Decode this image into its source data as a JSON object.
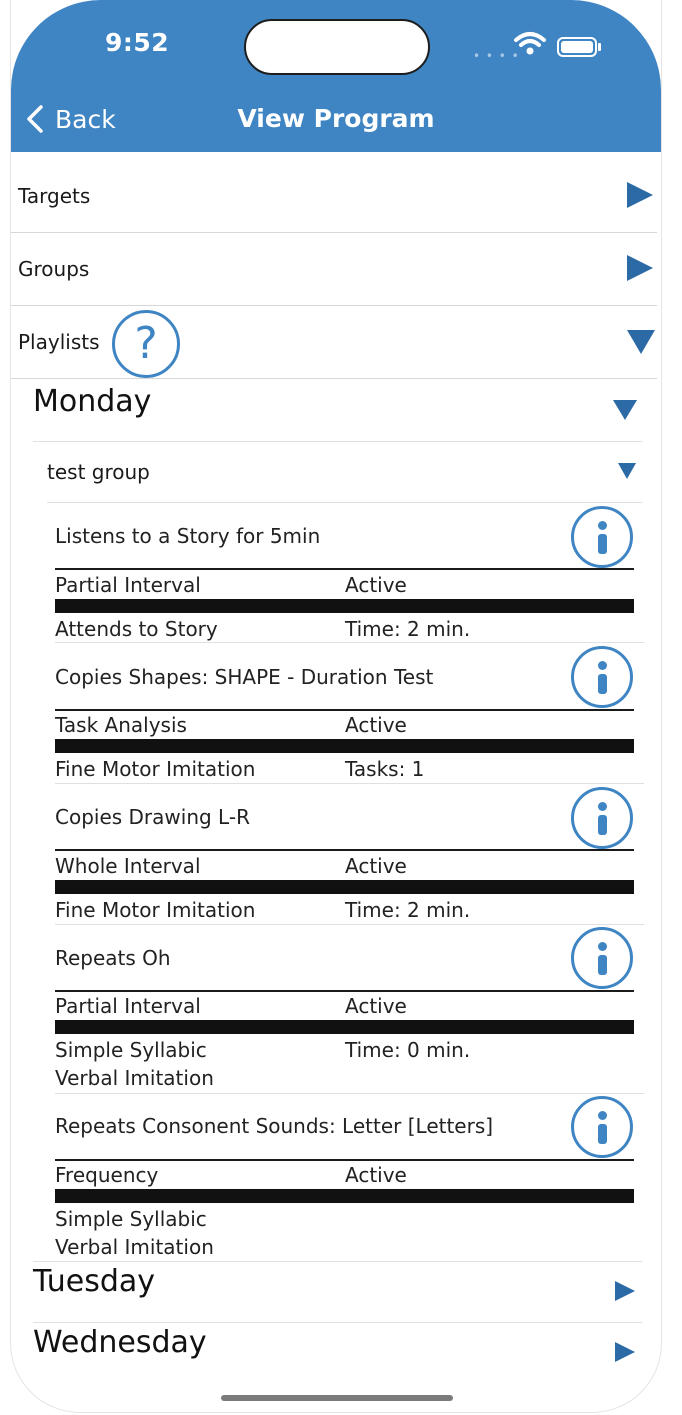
{
  "status_bar": {
    "time": "9:52"
  },
  "nav": {
    "back_label": "Back",
    "title": "View Program"
  },
  "sections": [
    {
      "label": "Targets"
    },
    {
      "label": "Groups"
    },
    {
      "label": "Playlists"
    }
  ],
  "help_glyph": "?",
  "days": [
    {
      "name": "Monday"
    },
    {
      "name": "Tuesday"
    },
    {
      "name": "Wednesday"
    }
  ],
  "group": {
    "name": "test group"
  },
  "items": [
    {
      "title": "Listens to a Story for 5min",
      "method": "Partial Interval",
      "status": "Active",
      "domain": [
        "Attends to Story"
      ],
      "metric": "Time: 2 min."
    },
    {
      "title": "Copies Shapes: SHAPE - Duration Test",
      "method": "Task Analysis",
      "status": "Active",
      "domain": [
        "Fine Motor Imitation"
      ],
      "metric": "Tasks: 1"
    },
    {
      "title": "Copies Drawing L-R",
      "method": "Whole Interval",
      "status": "Active",
      "domain": [
        "Fine Motor Imitation"
      ],
      "metric": "Time: 2 min."
    },
    {
      "title": "Repeats Oh",
      "method": "Partial Interval",
      "status": "Active",
      "domain": [
        "Simple Syllabic",
        "Verbal Imitation"
      ],
      "metric": "Time: 0 min."
    },
    {
      "title": "Repeats Consonent Sounds: Letter [Letters]",
      "method": "Frequency",
      "status": "Active",
      "domain": [
        "Simple Syllabic",
        "Verbal Imitation"
      ],
      "metric": ""
    }
  ],
  "colors": {
    "header": "#3f85c3",
    "accent": "#2c6aa5"
  }
}
